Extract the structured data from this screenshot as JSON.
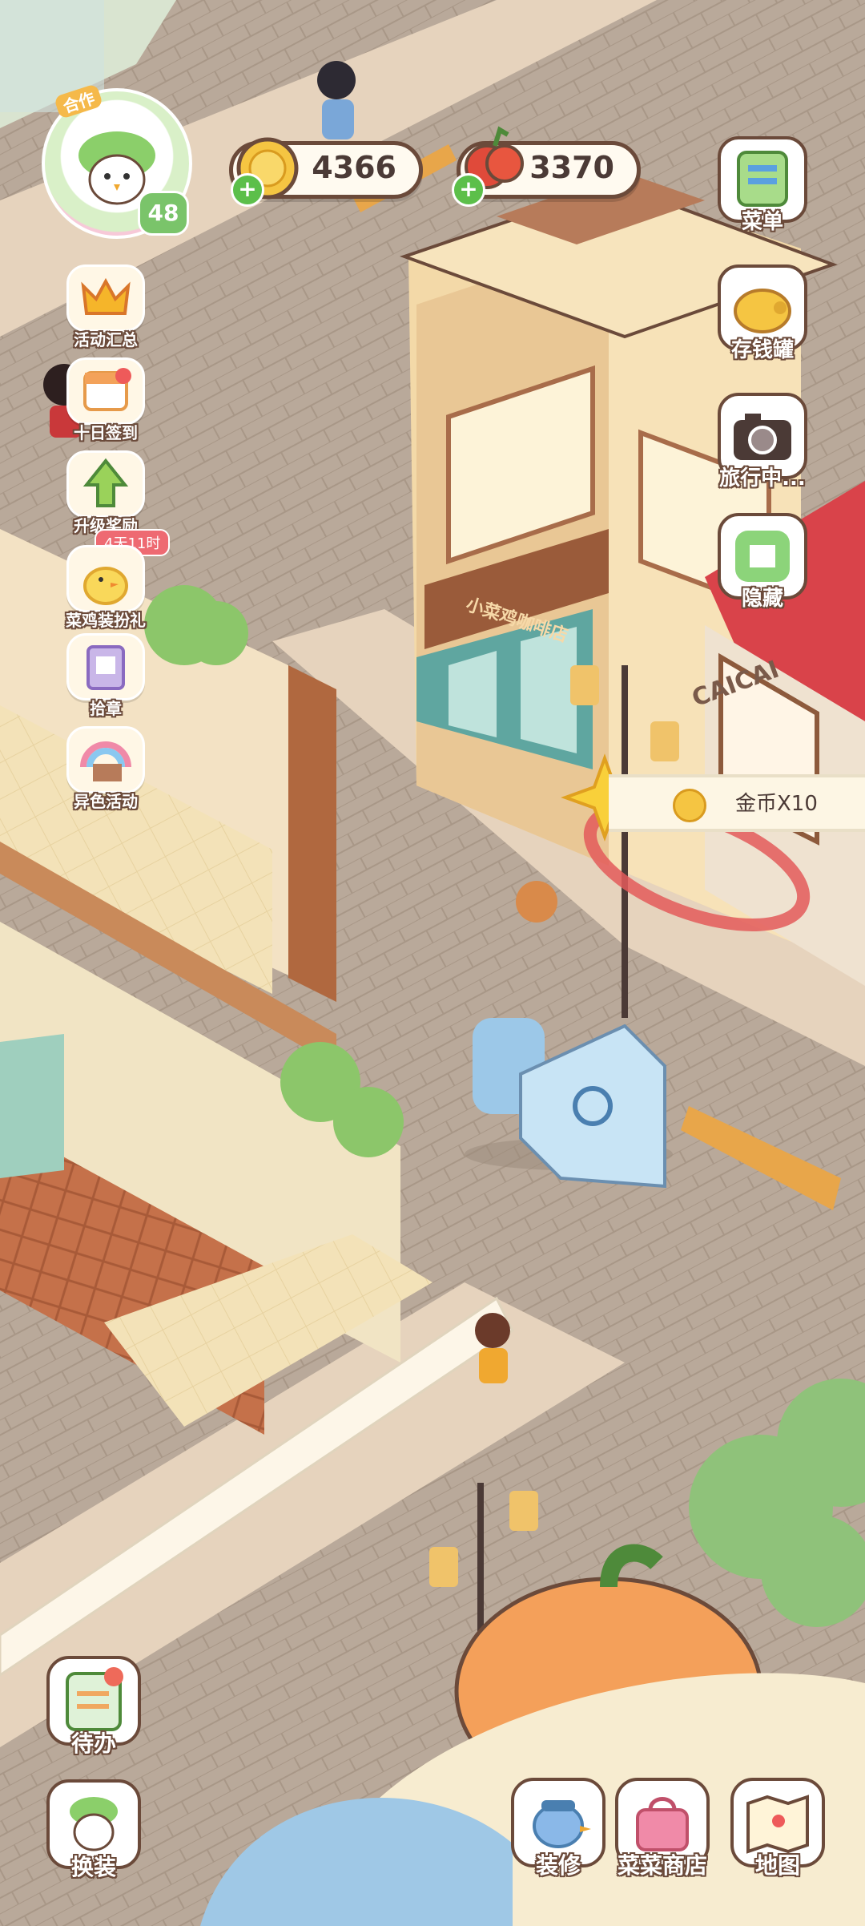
{
  "currency": {
    "coins": "4366",
    "tomatoes": "3370"
  },
  "player": {
    "level": "48",
    "banner": "合作"
  },
  "left_menu": [
    {
      "label": "活动汇总",
      "icon": "crown-icon"
    },
    {
      "label": "十日签到",
      "icon": "calendar-icon"
    },
    {
      "label": "升级奖励",
      "icon": "level-up-arrow-icon"
    },
    {
      "label": "菜鸡装扮礼",
      "icon": "chick-icon",
      "badge": "4天11时"
    },
    {
      "label": "拾章",
      "icon": "stamp-album-icon"
    },
    {
      "label": "异色活动",
      "icon": "rainbow-book-icon"
    }
  ],
  "right_menu": [
    {
      "label": "菜单",
      "icon": "menu-list-icon"
    },
    {
      "label": "存钱罐",
      "icon": "piggy-bank-icon"
    },
    {
      "label": "旅行中...",
      "icon": "camera-icon"
    },
    {
      "label": "隐藏",
      "icon": "hide-frame-icon"
    }
  ],
  "reward_popup": {
    "text": "金币X10",
    "icon": "coin-icon"
  },
  "shop_signs": {
    "cafe": "CAICAI",
    "shop_name": "小菜鸡咖啡店"
  },
  "bottom_left": [
    {
      "label": "待办",
      "icon": "todo-list-icon"
    },
    {
      "label": "换装",
      "icon": "outfit-icon"
    }
  ],
  "bottom_right": [
    {
      "label": "装修",
      "icon": "decorate-bird-icon"
    },
    {
      "label": "菜菜商店",
      "icon": "shop-bag-icon"
    },
    {
      "label": "地图",
      "icon": "map-icon"
    }
  ],
  "colors": {
    "street": "#b9a99a",
    "sidewalk": "#e6d3bd",
    "outline": "#6b4a3a",
    "coin": "#f5c542",
    "accent_green": "#7ac46a",
    "roof_red": "#d9434a"
  }
}
